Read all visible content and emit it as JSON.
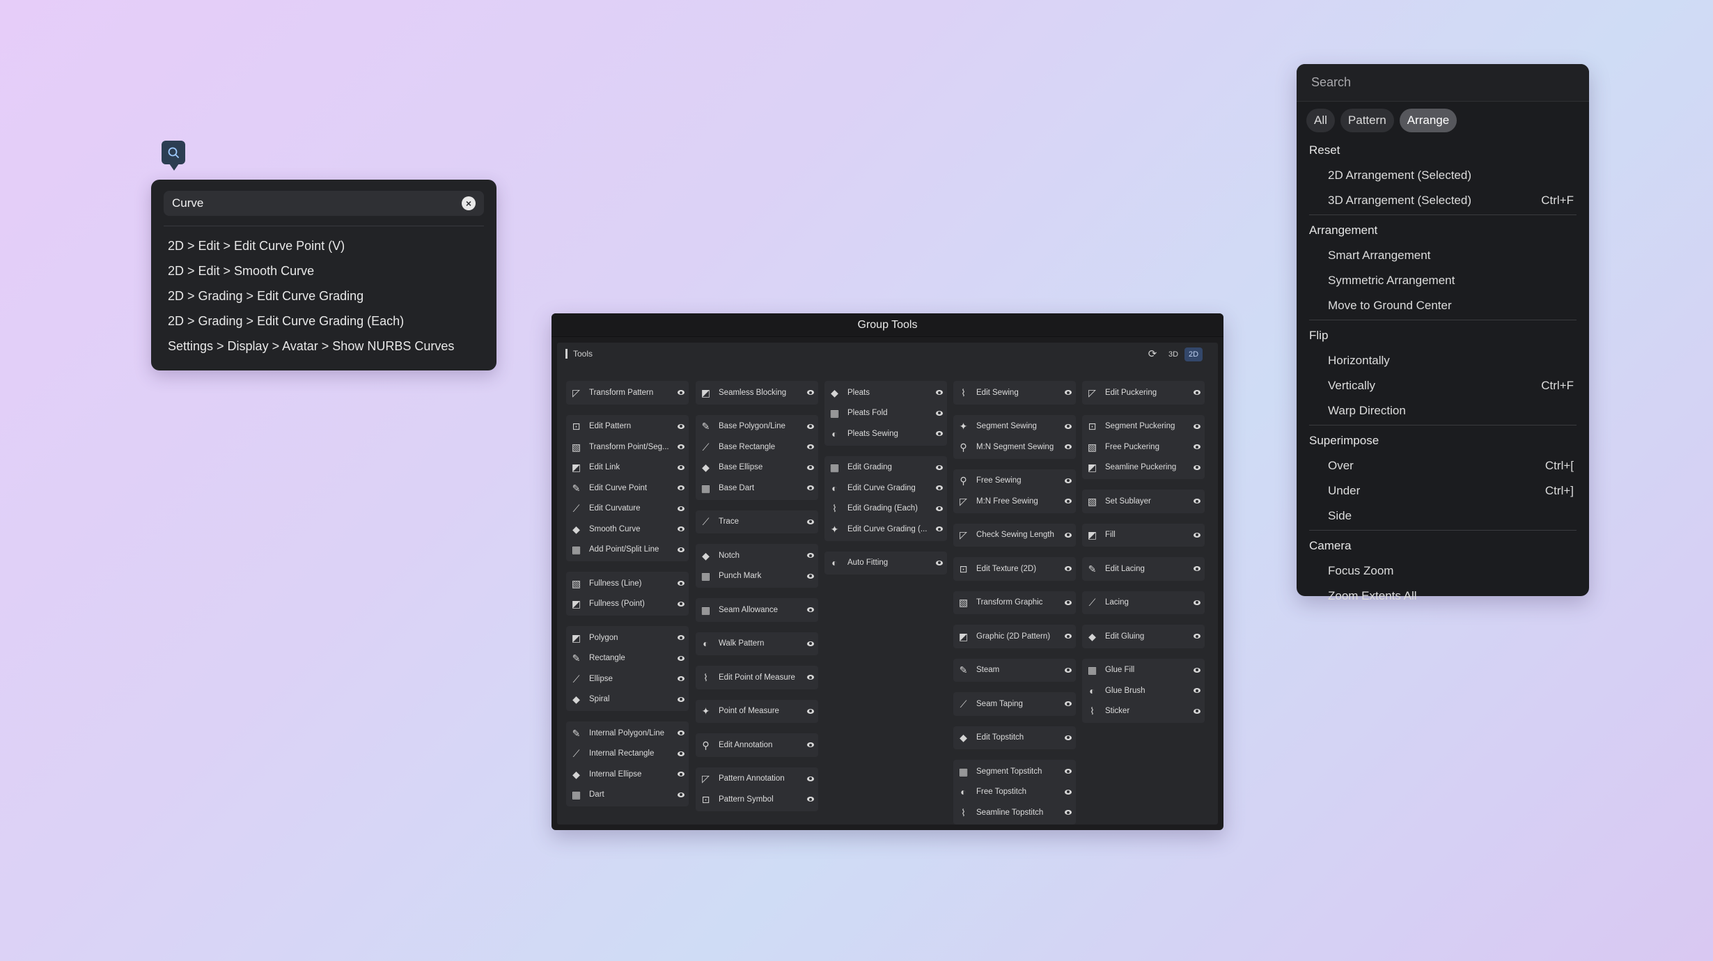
{
  "search_popup": {
    "query": "Curve",
    "results": [
      "2D > Edit > Edit Curve Point (V)",
      "2D > Edit > Smooth Curve",
      "2D > Grading > Edit Curve Grading",
      "2D > Grading > Edit Curve Grading (Each)",
      "Settings > Display > Avatar > Show NURBS Curves"
    ]
  },
  "group_tools": {
    "title": "Group Tools",
    "panel_label": "Tools",
    "toggle_3d": "3D",
    "toggle_2d": "2D",
    "active_toggle": "2D",
    "columns": [
      [
        [
          "Transform Pattern"
        ],
        [
          "Edit Pattern",
          "Transform Point/Seg...",
          "Edit Link",
          "Edit Curve Point",
          "Edit Curvature",
          "Smooth Curve",
          "Add Point/Split Line"
        ],
        [
          "Fullness (Line)",
          "Fullness (Point)"
        ],
        [
          "Polygon",
          "Rectangle",
          "Ellipse",
          "Spiral"
        ],
        [
          "Internal Polygon/Line",
          "Internal Rectangle",
          "Internal Ellipse",
          "Dart"
        ]
      ],
      [
        [
          "Seamless Blocking"
        ],
        [
          "Base Polygon/Line",
          "Base Rectangle",
          "Base Ellipse",
          "Base Dart"
        ],
        [
          "Trace"
        ],
        [
          "Notch",
          "Punch Mark"
        ],
        [
          "Seam Allowance"
        ],
        [
          "Walk Pattern"
        ],
        [
          "Edit Point of Measure"
        ],
        [
          "Point of Measure"
        ],
        [
          "Edit Annotation"
        ],
        [
          "Pattern Annotation",
          "Pattern Symbol"
        ]
      ],
      [
        [
          "Pleats",
          "Pleats Fold",
          "Pleats Sewing"
        ],
        [
          "Edit Grading",
          "Edit Curve Grading",
          "Edit Grading (Each)",
          "Edit Curve Grading (..."
        ],
        [
          "Auto Fitting"
        ]
      ],
      [
        [
          "Edit Sewing"
        ],
        [
          "Segment Sewing",
          "M:N Segment Sewing"
        ],
        [
          "Free Sewing",
          "M:N Free Sewing"
        ],
        [
          "Check Sewing Length"
        ],
        [
          "Edit Texture (2D)"
        ],
        [
          "Transform Graphic"
        ],
        [
          "Graphic (2D Pattern)"
        ],
        [
          "Steam"
        ],
        [
          "Seam Taping"
        ],
        [
          "Edit Topstitch"
        ],
        [
          "Segment Topstitch",
          "Free Topstitch",
          "Seamline Topstitch"
        ]
      ],
      [
        [
          "Edit Puckering"
        ],
        [
          "Segment Puckering",
          "Free Puckering",
          "Seamline Puckering"
        ],
        [
          "Set Sublayer"
        ],
        [
          "Fill"
        ],
        [
          "Edit Lacing"
        ],
        [
          "Lacing"
        ],
        [
          "Edit Gluing"
        ],
        [
          "Glue Fill",
          "Glue Brush",
          "Sticker"
        ]
      ]
    ]
  },
  "arrange_menu": {
    "search_placeholder": "Search",
    "filters": [
      "All",
      "Pattern",
      "Arrange"
    ],
    "active_filter": "Arrange",
    "sections": [
      {
        "title": "Reset",
        "items": [
          {
            "label": "2D Arrangement (Selected)",
            "shortcut": ""
          },
          {
            "label": "3D Arrangement (Selected)",
            "shortcut": "Ctrl+F"
          }
        ]
      },
      {
        "title": "Arrangement",
        "items": [
          {
            "label": "Smart Arrangement",
            "shortcut": ""
          },
          {
            "label": "Symmetric Arrangement",
            "shortcut": ""
          },
          {
            "label": "Move to Ground Center",
            "shortcut": ""
          }
        ]
      },
      {
        "title": "Flip",
        "items": [
          {
            "label": "Horizontally",
            "shortcut": ""
          },
          {
            "label": "Vertically",
            "shortcut": "Ctrl+F"
          },
          {
            "label": "Warp Direction",
            "shortcut": ""
          }
        ]
      },
      {
        "title": "Superimpose",
        "items": [
          {
            "label": "Over",
            "shortcut": "Ctrl+["
          },
          {
            "label": "Under",
            "shortcut": "Ctrl+]"
          },
          {
            "label": "Side",
            "shortcut": ""
          }
        ]
      },
      {
        "title": "Camera",
        "items": [
          {
            "label": "Focus Zoom",
            "shortcut": ""
          },
          {
            "label": "Zoom Extents All",
            "shortcut": ""
          }
        ]
      }
    ]
  }
}
